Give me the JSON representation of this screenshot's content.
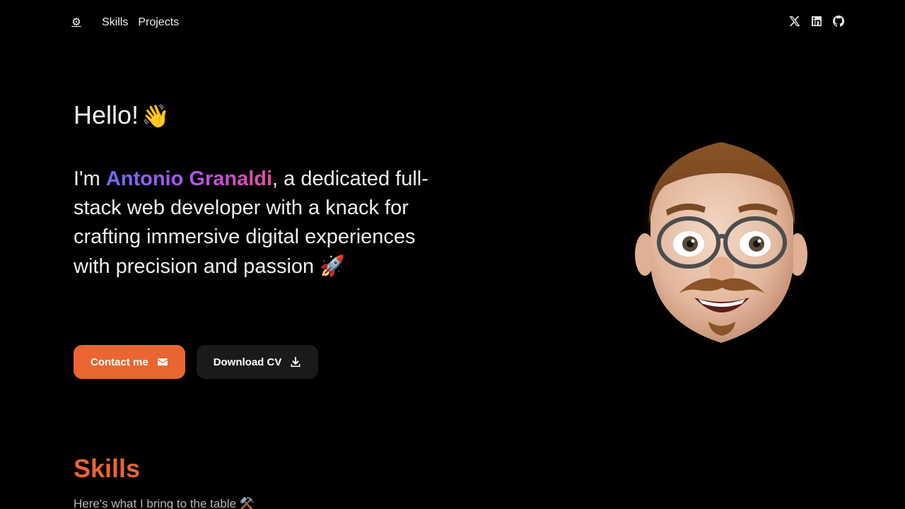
{
  "nav": {
    "logo_icon": "gear-icon",
    "links": [
      {
        "label": "Skills"
      },
      {
        "label": "Projects"
      }
    ],
    "socials": [
      {
        "icon": "x-twitter-icon"
      },
      {
        "icon": "linkedin-icon"
      },
      {
        "icon": "github-icon"
      }
    ]
  },
  "hero": {
    "greeting": "Hello!",
    "greeting_emoji": "👋",
    "intro_prefix": "I'm ",
    "name": "Antonio Granaldi",
    "intro_suffix": ", a dedicated full-stack web developer with a knack for crafting immersive digital experiences with precision and passion",
    "intro_emoji": "🚀",
    "buttons": {
      "contact_label": "Contact me",
      "contact_icon": "envelope-icon",
      "cv_label": "Download CV",
      "cv_icon": "download-icon"
    },
    "avatar_icon": "memoji-avatar-icon"
  },
  "skills": {
    "title": "Skills",
    "subtitle": "Here's what I bring to the table",
    "subtitle_emoji": "⚒️"
  },
  "colors": {
    "background": "#000000",
    "accent": "#ea6531",
    "button_secondary": "#1a1a1a",
    "name_gradient_start": "#6d6cf7",
    "name_gradient_mid": "#b654e8",
    "name_gradient_end": "#e64f9e"
  }
}
